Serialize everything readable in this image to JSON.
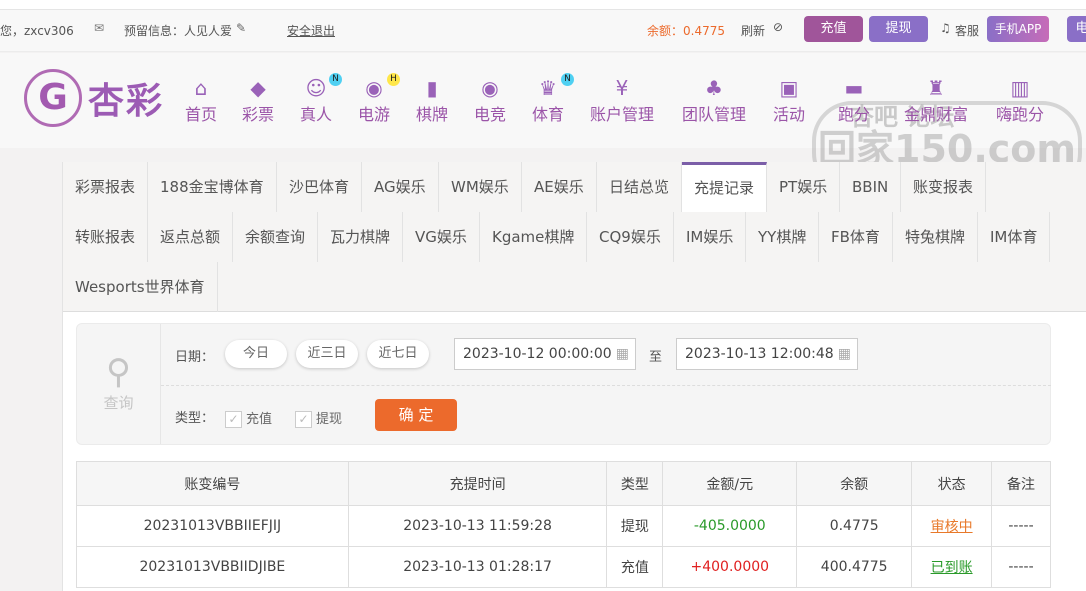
{
  "topbar": {
    "greeting": "您，zxcv306",
    "message_label": "预留信息：人见人爱",
    "logout": "安全退出",
    "balance": "余额：0.4775",
    "refresh": "刷新",
    "deposit": "充值",
    "withdraw": "提现",
    "service": "客服",
    "app": "手机APP",
    "more": "电"
  },
  "logo": {
    "text": "杏彩"
  },
  "nav": [
    {
      "label": "首页",
      "icon": "home-icon"
    },
    {
      "label": "彩票",
      "icon": "ticket-icon"
    },
    {
      "label": "真人",
      "icon": "dealer-icon",
      "badge": "N"
    },
    {
      "label": "电游",
      "icon": "gamepad-icon",
      "badge": "H"
    },
    {
      "label": "棋牌",
      "icon": "cards-icon"
    },
    {
      "label": "电竞",
      "icon": "gamepad-icon"
    },
    {
      "label": "体育",
      "icon": "trophy-icon",
      "badge": "N"
    },
    {
      "label": "账户管理",
      "icon": "yen-icon"
    },
    {
      "label": "团队管理",
      "icon": "team-icon"
    },
    {
      "label": "活动",
      "icon": "gift-icon"
    },
    {
      "label": "跑分",
      "icon": "car-icon"
    },
    {
      "label": "金鼎财富",
      "icon": "throne-icon"
    },
    {
      "label": "嗨跑分",
      "icon": "hi-icon"
    }
  ],
  "watermark": {
    "top": "杏吧 论坛",
    "bottom": "回家150.com"
  },
  "tabs": [
    [
      "彩票报表",
      "188金宝博体育",
      "沙巴体育",
      "AG娱乐",
      "WM娱乐",
      "AE娱乐",
      "日结总览",
      "充提记录",
      "PT娱乐",
      "BBIN",
      "账变报表"
    ],
    [
      "转账报表",
      "返点总额",
      "余额查询",
      "瓦力棋牌",
      "VG娱乐",
      "Kgame棋牌",
      "CQ9娱乐",
      "IM娱乐",
      "YY棋牌",
      "FB体育",
      "特兔棋牌",
      "IM体育"
    ],
    [
      "Wesports世界体育"
    ]
  ],
  "active_tab": "充提记录",
  "query": {
    "label": "查询",
    "date_label": "日期：",
    "today": "今日",
    "three_days": "近三日",
    "seven_days": "近七日",
    "start": "2023-10-12 00:00:00",
    "to": "至",
    "end": "2023-10-13 12:00:48",
    "type_label": "类型：",
    "type_deposit": "充值",
    "type_withdraw": "提现",
    "confirm": "确 定"
  },
  "table": {
    "headers": [
      "账变编号",
      "充提时间",
      "类型",
      "金额/元",
      "余额",
      "状态",
      "备注"
    ],
    "rows": [
      [
        "20231013VBBIIEFJIJ",
        "2023-10-13 11:59:28",
        "提现",
        "-405.0000",
        "0.4775",
        "审核中",
        "-----"
      ],
      [
        "20231013VBBIIDJIBE",
        "2023-10-13 01:28:17",
        "充值",
        "+400.0000",
        "400.4775",
        "已到账",
        "-----"
      ]
    ]
  },
  "colors": {
    "accent": "#7b5ea8",
    "negative": "#2a9a2a",
    "positive": "#e02020",
    "pending": "#e8792a",
    "done": "#2a9a2a",
    "confirm": "#ec6a2c"
  }
}
